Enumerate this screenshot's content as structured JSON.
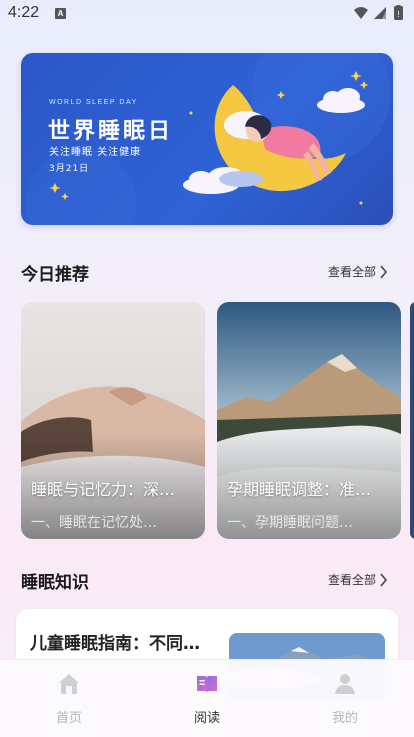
{
  "status_bar": {
    "time": "4:22",
    "notification_badge": "A"
  },
  "banner": {
    "english_title": "WORLD SLEEP DAY",
    "title": "世界睡眠日",
    "subtitle": "关注睡眠  关注健康",
    "date": "3月21日"
  },
  "today_recommend": {
    "title": "今日推荐",
    "see_all": "查看全部",
    "cards": [
      {
        "title": "睡眠与记忆力：深…",
        "subtitle": "一、睡眠在记忆处…"
      },
      {
        "title": "孕期睡眠调整：准…",
        "subtitle": "一、孕期睡眠问题…"
      }
    ]
  },
  "sleep_knowledge": {
    "title": "睡眠知识",
    "see_all": "查看全部",
    "items": [
      {
        "title": "儿童睡眠指南：不同…"
      }
    ]
  },
  "tab_bar": {
    "tabs": [
      {
        "label": "首页",
        "icon": "home-icon",
        "active": false
      },
      {
        "label": "阅读",
        "icon": "book-icon",
        "active": true
      },
      {
        "label": "我的",
        "icon": "profile-icon",
        "active": false
      }
    ]
  },
  "colors": {
    "accent": "#9b6be0",
    "banner_blue": "#2f62d6",
    "moon_yellow": "#f5c842"
  }
}
